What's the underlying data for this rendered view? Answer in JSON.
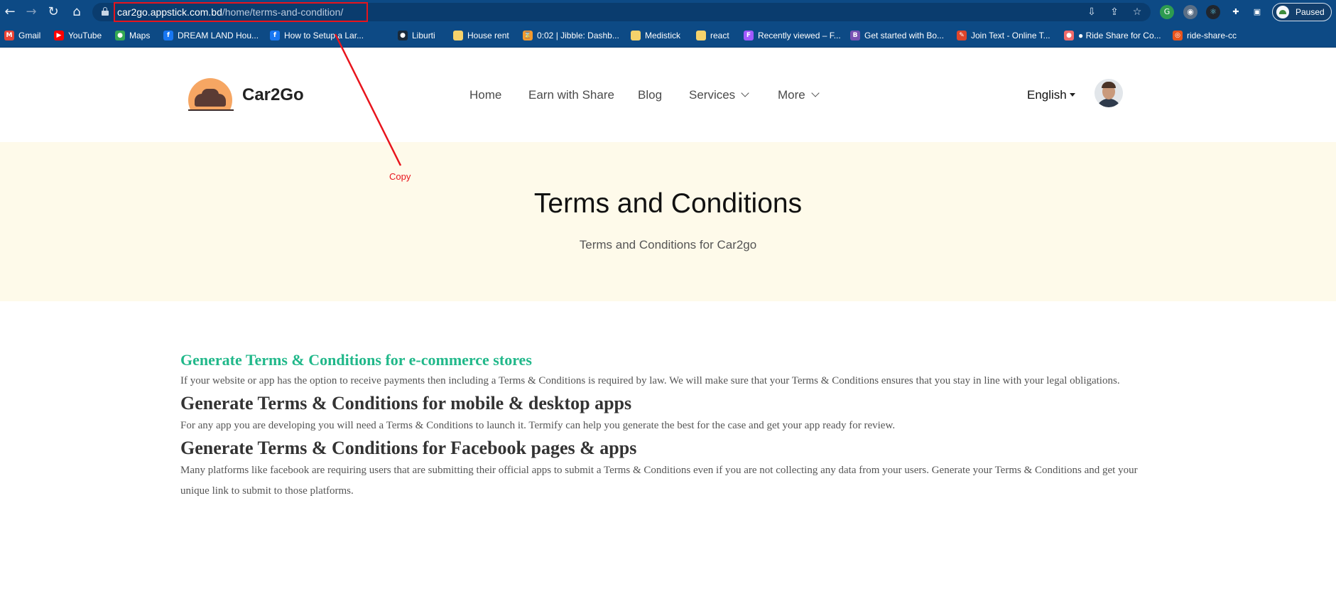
{
  "browser": {
    "url_host": "car2go.appstick.com.bd",
    "url_path": "/home/terms-and-condition/",
    "profile_status": "Paused",
    "bookmarks": [
      {
        "label": "Gmail",
        "icon": "gmail-icon",
        "color": "#ea4335",
        "glyph": "M"
      },
      {
        "label": "YouTube",
        "icon": "youtube-icon",
        "color": "#ff0000",
        "glyph": "▶"
      },
      {
        "label": "Maps",
        "icon": "maps-icon",
        "color": "#34a853",
        "glyph": "●"
      },
      {
        "label": "DREAM LAND Hou...",
        "icon": "facebook-icon",
        "color": "#1877f2",
        "glyph": "f"
      },
      {
        "label": "How to Setup a Lar...",
        "icon": "globe-icon",
        "color": "#1877f2",
        "glyph": "f"
      },
      {
        "label": "Liburti",
        "icon": "github-icon",
        "color": "#1a2a3a",
        "glyph": "●"
      },
      {
        "label": "House rent",
        "icon": "folder-icon",
        "color": "#f5d26b",
        "glyph": ""
      },
      {
        "label": "0:02 | Jibble: Dashb...",
        "icon": "jibble-icon",
        "color": "#f29a2e",
        "glyph": "⌛"
      },
      {
        "label": "Medistick",
        "icon": "folder-icon",
        "color": "#f5d26b",
        "glyph": ""
      },
      {
        "label": "react",
        "icon": "folder-icon",
        "color": "#f5d26b",
        "glyph": ""
      },
      {
        "label": "Recently viewed – F...",
        "icon": "figma-icon",
        "color": "#a259ff",
        "glyph": "F"
      },
      {
        "label": "Get started with Bo...",
        "icon": "bootstrap-icon",
        "color": "#7952b3",
        "glyph": "B"
      },
      {
        "label": "Join Text - Online T...",
        "icon": "tool-icon",
        "color": "#e0452b",
        "glyph": "✎"
      },
      {
        "label": "● Ride Share for Co...",
        "icon": "asana-icon",
        "color": "#f06a6a",
        "glyph": "●"
      },
      {
        "label": "ride-share-cc",
        "icon": "ride-share-icon",
        "color": "#e8541c",
        "glyph": "◎"
      }
    ]
  },
  "site": {
    "brand": "Car2Go",
    "nav": {
      "home": "Home",
      "earn": "Earn with Share",
      "blog": "Blog",
      "services": "Services",
      "more": "More"
    },
    "language": "English"
  },
  "hero": {
    "title": "Terms and Conditions",
    "subtitle": "Terms and Conditions for Car2go"
  },
  "content": {
    "section1_title": "Generate Terms & Conditions for e-commerce stores",
    "section1_body": "If your website or app has the option to receive payments then including a Terms & Conditions is required by law. We will make sure that your Terms & Conditions ensures that you stay in line with your legal obligations.",
    "section2_title": "Generate Terms & Conditions for mobile & desktop apps",
    "section2_body": "For any app you are developing you will need a Terms & Conditions to launch it. Termify can help you generate the best for the case and get your app ready for review.",
    "section3_title": "Generate Terms & Conditions for Facebook pages & apps",
    "section3_body": "Many platforms like facebook are requiring users that are submitting their official apps to submit a Terms & Conditions even if you are not collecting any data from your users. Generate your Terms & Conditions and get your unique link to submit to those platforms."
  },
  "annotation": {
    "label": "Copy",
    "color": "#e8141c"
  },
  "colors": {
    "browser_chrome": "#0d4a85",
    "hero_background": "#fefaea",
    "accent_green": "#21b88a"
  }
}
